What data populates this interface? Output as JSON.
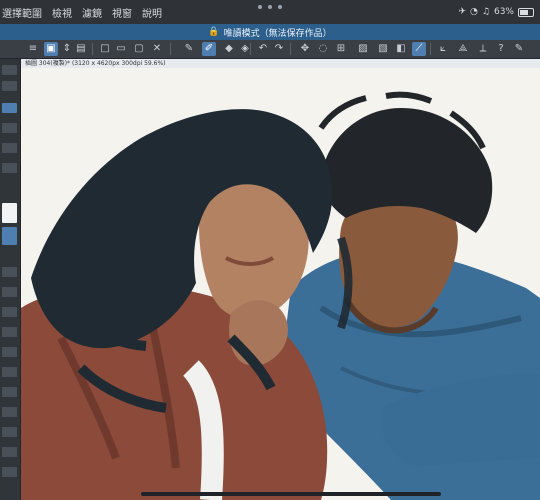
{
  "menu": [
    "選擇範圍",
    "檢視",
    "濾鏡",
    "視窗",
    "說明"
  ],
  "status": {
    "battery": "63%"
  },
  "banner": {
    "text": "唯讀模式（無法保存作品）",
    "icon": "lock-icon"
  },
  "toolbar": {
    "icons": [
      "menu-icon",
      "layer-icon",
      "navigator-icon",
      "new-file-icon",
      "open-icon",
      "save-icon",
      "close-icon",
      "pen-icon",
      "brush-icon",
      "eraser-icon",
      "fill-icon",
      "undo-icon",
      "redo-icon",
      "move-icon",
      "lasso-icon",
      "transform-icon",
      "select-icon",
      "eyedropper-icon",
      "ruler-icon",
      "help-icon"
    ]
  },
  "document": {
    "tab_label": "插圖 304(複製)* (3120 x 4620px 300dpi 59.6%)"
  },
  "colors": {
    "accent": "#4f7fb0",
    "banner": "#2c5f8c",
    "panel": "#30353a",
    "canvas": "#f5f3ee"
  }
}
